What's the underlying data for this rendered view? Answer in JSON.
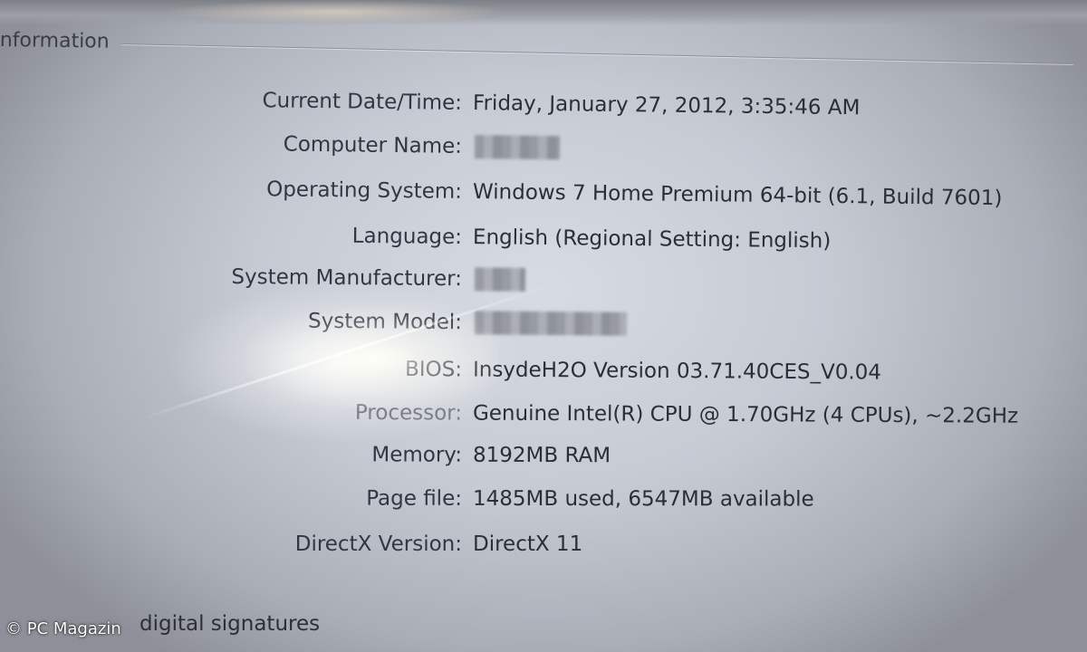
{
  "window": {
    "group_title": "nformation"
  },
  "system_info": [
    {
      "label": "Current Date/Time:",
      "value": "Friday, January 27, 2012, 3:35:46 AM",
      "redacted": false
    },
    {
      "label": "Computer Name:",
      "value": "",
      "redacted": true
    },
    {
      "label": "Operating System:",
      "value": "Windows 7 Home Premium 64-bit (6.1, Build 7601)",
      "redacted": false
    },
    {
      "label": "Language:",
      "value": "English (Regional Setting: English)",
      "redacted": false
    },
    {
      "label": "System Manufacturer:",
      "value": "",
      "redacted": true
    },
    {
      "label": "System Model:",
      "value": "",
      "redacted": true
    },
    {
      "label": "BIOS:",
      "value": "InsydeH2O Version 03.71.40CES_V0.04",
      "redacted": false
    },
    {
      "label": "Processor:",
      "value": "Genuine Intel(R) CPU  @ 1.70GHz (4 CPUs), ~2.2GHz",
      "redacted": false
    },
    {
      "label": "Memory:",
      "value": "8192MB RAM",
      "redacted": false
    },
    {
      "label": "Page file:",
      "value": "1485MB used, 6547MB available",
      "redacted": false
    },
    {
      "label": "DirectX Version:",
      "value": "DirectX 11",
      "redacted": false
    }
  ],
  "footer": {
    "checkbox_label_tail": "digital signatures",
    "watermark": "© PC Magazin"
  }
}
